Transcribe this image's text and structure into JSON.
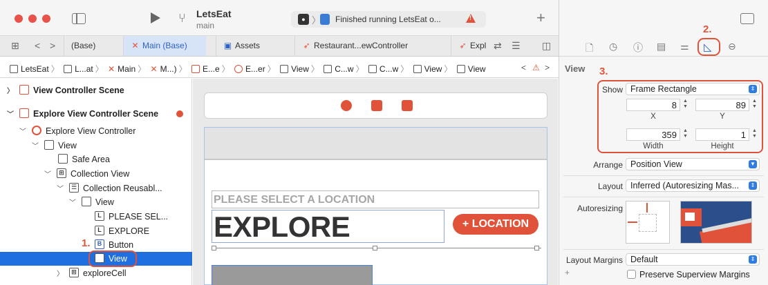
{
  "toolbar": {
    "scheme_title": "LetsEat",
    "scheme_subtitle": "main",
    "activity_text": "Finished running LetsEat o...",
    "add_label": "+"
  },
  "tabs": [
    {
      "label": "(Base)",
      "icon": "storyboard-icon"
    },
    {
      "label": "Main (Base)",
      "icon": "storyboard-x-icon",
      "active": true
    },
    {
      "label": "Assets",
      "icon": "assets-icon"
    },
    {
      "label": "Restaurant...ewController",
      "icon": "swift-icon"
    },
    {
      "label": "Expl",
      "icon": "swift-icon"
    }
  ],
  "jumpbar": {
    "items": [
      "LetsEat",
      "L...at",
      "Main",
      "M...)",
      "E...e",
      "E...er",
      "View",
      "C...w",
      "C...w",
      "View",
      "View"
    ]
  },
  "outline": {
    "rows": [
      {
        "label": "View Controller Scene",
        "bold": true
      },
      {
        "label": "Explore View Controller Scene",
        "bold": true
      },
      {
        "label": "Explore View Controller"
      },
      {
        "label": "View"
      },
      {
        "label": "Safe Area"
      },
      {
        "label": "Collection View"
      },
      {
        "label": "Collection Reusabl..."
      },
      {
        "label": "View"
      },
      {
        "label": "PLEASE SEL...",
        "icon_text": "L"
      },
      {
        "label": "EXPLORE",
        "icon_text": "L"
      },
      {
        "label": "Button",
        "icon_text": "B"
      },
      {
        "label": "View",
        "selected": true
      },
      {
        "label": "exploreCell"
      }
    ]
  },
  "canvas": {
    "subtitle": "PLEASE SELECT A LOCATION",
    "title": "EXPLORE",
    "location_button": "+ LOCATION"
  },
  "inspector": {
    "section": "View",
    "show_label": "Show",
    "show_value": "Frame Rectangle",
    "x_value": "8",
    "y_value": "89",
    "x_label": "X",
    "y_label": "Y",
    "width_value": "359",
    "height_value": "1",
    "width_label": "Width",
    "height_label": "Height",
    "arrange_label": "Arrange",
    "arrange_value": "Position View",
    "layout_label": "Layout",
    "layout_value": "Inferred (Autoresizing Mas...",
    "autoresizing_label": "Autoresizing",
    "layout_margins_label": "Layout Margins",
    "layout_margins_value": "Default",
    "preserve_label": "Preserve Superview Margins",
    "plus_label": "+"
  },
  "annotations": {
    "step1": "1.",
    "step2": "2.",
    "step3": "3."
  },
  "colors": {
    "accent": "#e0533a",
    "selection": "#1f6fe0",
    "link": "#2f62c4"
  }
}
